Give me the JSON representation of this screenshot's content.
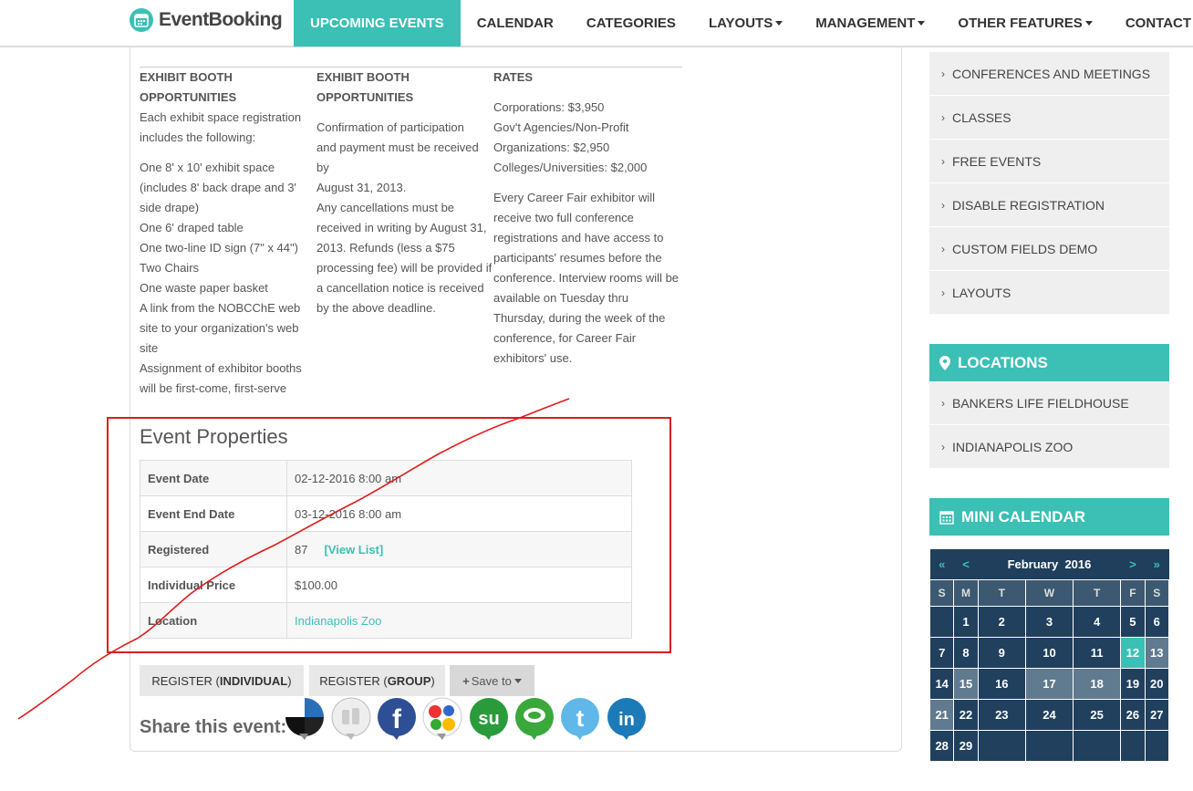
{
  "brand": {
    "name": "EventBooking"
  },
  "nav": {
    "items": [
      {
        "label": "UPCOMING EVENTS",
        "active": true,
        "dropdown": false
      },
      {
        "label": "CALENDAR",
        "active": false,
        "dropdown": false
      },
      {
        "label": "CATEGORIES",
        "active": false,
        "dropdown": false
      },
      {
        "label": "LAYOUTS",
        "active": false,
        "dropdown": true
      },
      {
        "label": "MANAGEMENT",
        "active": false,
        "dropdown": true
      },
      {
        "label": "OTHER FEATURES",
        "active": false,
        "dropdown": true
      },
      {
        "label": "CONTACT US",
        "active": false,
        "dropdown": false
      }
    ]
  },
  "content": {
    "col1": {
      "heading": [
        "EXHIBIT BOOTH",
        "OPPORTUNITIES"
      ],
      "intro": [
        "Each exhibit space registration",
        "includes the following:"
      ],
      "lines": [
        "One 8' x 10' exhibit space",
        "(includes 8' back drape and 3'",
        "side drape)",
        "One 6' draped table",
        "One two-line ID sign (7\" x 44\")",
        "Two Chairs",
        "One waste paper basket",
        "A link from the NOBCChE web",
        "site to your organization's web",
        "site",
        "Assignment of exhibitor booths",
        "will be first-come, first-serve"
      ]
    },
    "col2": {
      "heading": [
        "EXHIBIT BOOTH",
        "OPPORTUNITIES"
      ],
      "lines": [
        "Confirmation of participation",
        "and payment must be received by",
        "August 31, 2013.",
        "Any cancellations must be",
        "received in writing by August 31,",
        "2013. Refunds (less a $75",
        "processing fee) will be provided if",
        "a cancellation notice is received",
        "by the above deadline."
      ]
    },
    "col3": {
      "heading": "RATES",
      "rates": [
        "Corporations: $3,950",
        "Gov't Agencies/Non-Profit",
        "Organizations: $2,950",
        "Colleges/Universities: $2,000"
      ],
      "lines": [
        "Every Career Fair exhibitor will",
        "receive two full conference",
        "registrations and have access to",
        "participants' resumes before the",
        "conference. Interview rooms will be",
        "available on Tuesday thru",
        "Thursday, during the week of the",
        "conference, for Career Fair",
        "exhibitors' use."
      ]
    }
  },
  "properties": {
    "title": "Event Properties",
    "rows": [
      {
        "key": "Event Date",
        "value": "02-12-2016 8:00 am"
      },
      {
        "key": "Event End Date",
        "value": "03-12-2016 8:00 am"
      },
      {
        "key": "Registered",
        "value": "87",
        "link": "[View List]"
      },
      {
        "key": "Individual Price",
        "value": "$100.00"
      },
      {
        "key": "Location",
        "value": "Indianapolis Zoo"
      }
    ]
  },
  "actions": {
    "register_individual_prefix": "REGISTER (",
    "register_individual_bold": "INDIVIDUAL",
    "register_group_prefix": "REGISTER (",
    "register_group_bold": "GROUP",
    "close_paren": ")",
    "save_to": "Save to"
  },
  "share": {
    "label": "Share this event:",
    "icons": [
      "delicious-icon",
      "digg-icon",
      "facebook-icon",
      "google-icon",
      "stumbleupon-icon",
      "technorati-icon",
      "twitter-icon",
      "linkedin-icon"
    ]
  },
  "sidebar": {
    "categories": [
      "CONFERENCES AND MEETINGS",
      "CLASSES",
      "FREE EVENTS",
      "DISABLE REGISTRATION",
      "CUSTOM FIELDS DEMO",
      "LAYOUTS"
    ],
    "locations_title": "LOCATIONS",
    "locations": [
      "BANKERS LIFE FIELDHOUSE",
      "INDIANAPOLIS ZOO"
    ],
    "calendar_title": "MINI CALENDAR"
  },
  "calendar": {
    "month": "February",
    "year": "2016",
    "prev_year": "«",
    "prev_month": "<",
    "next_month": ">",
    "next_year": "»",
    "weekdays": [
      "S",
      "M",
      "T",
      "W",
      "T",
      "F",
      "S"
    ],
    "weeks": [
      [
        "",
        "1",
        "2",
        "3",
        "4",
        "5",
        "6"
      ],
      [
        "7",
        "8",
        "9",
        "10",
        "11",
        "12",
        "13"
      ],
      [
        "14",
        "15",
        "16",
        "17",
        "18",
        "19",
        "20"
      ],
      [
        "21",
        "22",
        "23",
        "24",
        "25",
        "26",
        "27"
      ],
      [
        "28",
        "29",
        "",
        "",
        "",
        "",
        ""
      ]
    ],
    "today": "12",
    "highlighted": [
      "13",
      "15",
      "17",
      "18",
      "21"
    ]
  },
  "colors": {
    "accent": "#3cbfb5",
    "calendar": "#20405e",
    "annotation": "#e01b1b"
  }
}
